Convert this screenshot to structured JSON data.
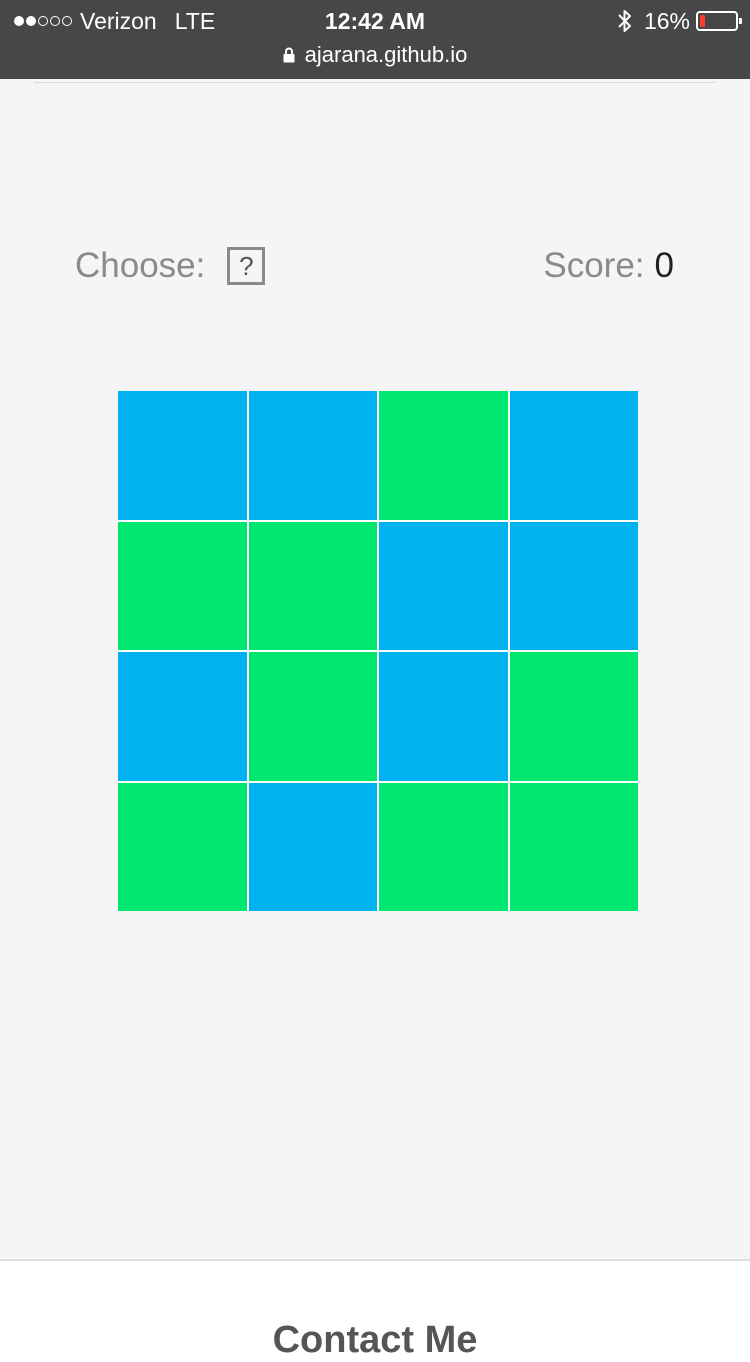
{
  "status_bar": {
    "carrier": "Verizon",
    "network": "LTE",
    "time": "12:42 AM",
    "battery": "16%",
    "battery_level": 0.16,
    "url": "ajarana.github.io"
  },
  "game": {
    "choose_label": "Choose:",
    "choose_value": "?",
    "score_label": "Score:",
    "score_value": "0",
    "colors": {
      "blue": "#00b3f0",
      "green": "#00e870"
    },
    "tiles": [
      "blue",
      "blue",
      "green",
      "blue",
      "green",
      "green",
      "blue",
      "blue",
      "blue",
      "green",
      "blue",
      "green",
      "green",
      "blue",
      "green",
      "green"
    ]
  },
  "footer": {
    "heading": "Contact Me"
  }
}
